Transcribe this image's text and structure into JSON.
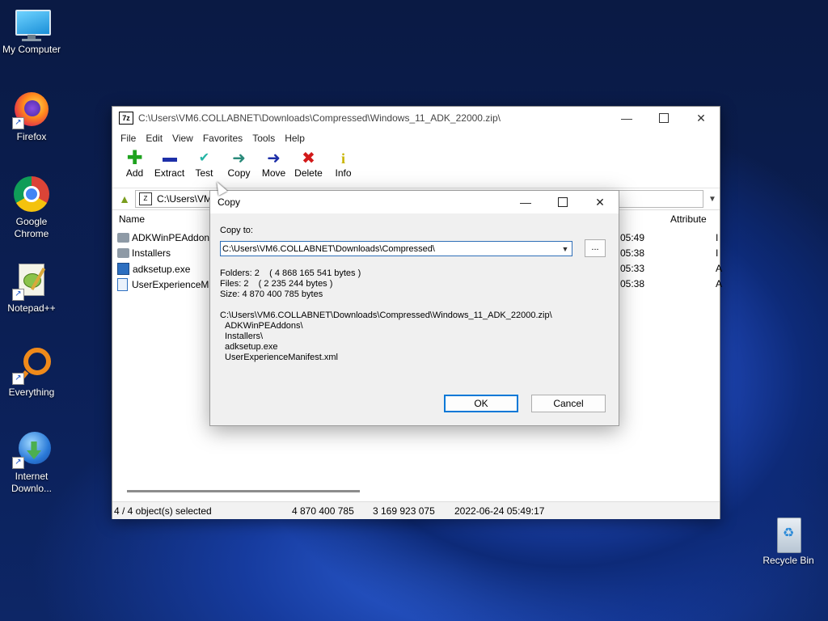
{
  "desktop": {
    "icons": [
      {
        "label": "My Computer"
      },
      {
        "label": "Firefox"
      },
      {
        "label": "Google Chrome"
      },
      {
        "label": "Notepad++"
      },
      {
        "label": "Everything"
      },
      {
        "label": "Internet Downlo..."
      },
      {
        "label": "Recycle Bin"
      }
    ]
  },
  "window": {
    "title": "C:\\Users\\VM6.COLLABNET\\Downloads\\Compressed\\Windows_11_ADK_22000.zip\\",
    "app_icon": "7z",
    "menu": [
      "File",
      "Edit",
      "View",
      "Favorites",
      "Tools",
      "Help"
    ],
    "toolbar": [
      {
        "label": "Add",
        "icon": "plus-icon",
        "color": "#1fa31f"
      },
      {
        "label": "Extract",
        "icon": "minus-icon",
        "color": "#1d2fa8"
      },
      {
        "label": "Test",
        "icon": "check-icon",
        "color": "#25b5a5"
      },
      {
        "label": "Copy",
        "icon": "copy-arrow-icon",
        "color": "#2a8a7a"
      },
      {
        "label": "Move",
        "icon": "move-arrow-icon",
        "color": "#1d2fa8"
      },
      {
        "label": "Delete",
        "icon": "x-icon",
        "color": "#d21919"
      },
      {
        "label": "Info",
        "icon": "info-icon",
        "color": "#c9b400"
      }
    ],
    "address": "C:\\Users\\VM",
    "columns": {
      "name": "Name",
      "attributes": "Attribute"
    },
    "files": [
      {
        "name": "ADKWinPEAddons",
        "type": "folder",
        "time": "05:49",
        "attr": "I"
      },
      {
        "name": "Installers",
        "type": "folder",
        "time": "05:38",
        "attr": "I"
      },
      {
        "name": "adksetup.exe",
        "type": "exe",
        "time": "05:33",
        "attr": "A"
      },
      {
        "name": "UserExperienceMa",
        "type": "xml",
        "time": "05:38",
        "attr": "A"
      }
    ],
    "status": {
      "selected": "4 / 4 object(s) selected",
      "size": "4 870 400 785",
      "packed": "3 169 923 075",
      "modified": "2022-06-24 05:49:17"
    }
  },
  "dialog": {
    "title": "Copy",
    "copy_to_label": "Copy to:",
    "path_value": "C:\\Users\\VM6.COLLABNET\\Downloads\\Compressed\\",
    "browse_label": "...",
    "folders": "Folders: 2    ( 4 868 165 541 bytes )",
    "files": "Files: 2    ( 2 235 244 bytes )",
    "size": "Size: 4 870 400 785 bytes",
    "source_path": "C:\\Users\\VM6.COLLABNET\\Downloads\\Compressed\\Windows_11_ADK_22000.zip\\",
    "items": [
      "ADKWinPEAddons\\",
      "Installers\\",
      "adksetup.exe",
      "UserExperienceManifest.xml"
    ],
    "ok_label": "OK",
    "cancel_label": "Cancel"
  }
}
